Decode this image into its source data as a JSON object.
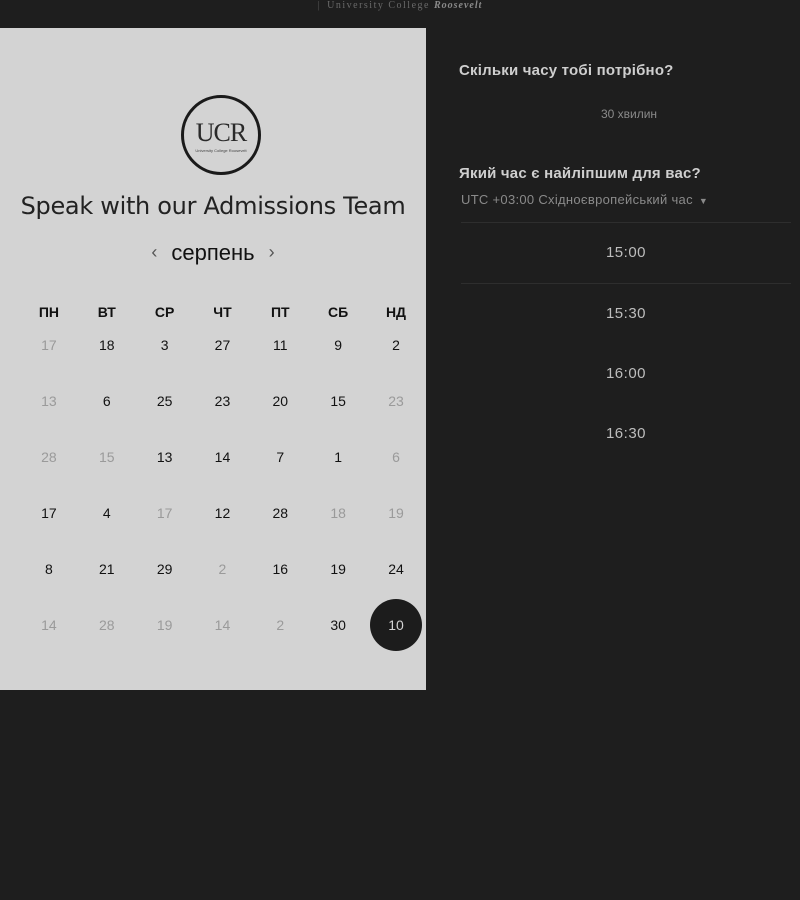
{
  "header": {
    "brand_prefix": "University College",
    "brand_name": "Roosevelt"
  },
  "logo": {
    "text": "UCR",
    "subtext": "University College Roosevelt"
  },
  "left_panel": {
    "title": "Speak with our Admissions Team",
    "month": "серпень",
    "prev_icon": "chevron-left-icon",
    "next_icon": "chevron-right-icon"
  },
  "calendar": {
    "weekdays": [
      "ПН",
      "ВТ",
      "СР",
      "ЧТ",
      "ПТ",
      "СБ",
      "НД"
    ],
    "weeks": [
      [
        {
          "d": "17",
          "s": "out"
        },
        {
          "d": "18",
          "s": "in"
        },
        {
          "d": "3",
          "s": "in"
        },
        {
          "d": "27",
          "s": "in"
        },
        {
          "d": "11",
          "s": "in"
        },
        {
          "d": "9",
          "s": "in"
        },
        {
          "d": "2",
          "s": "in"
        }
      ],
      [
        {
          "d": "13",
          "s": "out"
        },
        {
          "d": "6",
          "s": "in"
        },
        {
          "d": "25",
          "s": "in"
        },
        {
          "d": "23",
          "s": "in"
        },
        {
          "d": "20",
          "s": "in"
        },
        {
          "d": "15",
          "s": "in"
        },
        {
          "d": "23",
          "s": "out"
        }
      ],
      [
        {
          "d": "28",
          "s": "out"
        },
        {
          "d": "15",
          "s": "out"
        },
        {
          "d": "13",
          "s": "in"
        },
        {
          "d": "14",
          "s": "in"
        },
        {
          "d": "7",
          "s": "in"
        },
        {
          "d": "1",
          "s": "in"
        },
        {
          "d": "6",
          "s": "out"
        }
      ],
      [
        {
          "d": "17",
          "s": "in"
        },
        {
          "d": "4",
          "s": "in"
        },
        {
          "d": "17",
          "s": "out"
        },
        {
          "d": "12",
          "s": "in"
        },
        {
          "d": "28",
          "s": "in"
        },
        {
          "d": "18",
          "s": "out"
        },
        {
          "d": "19",
          "s": "out"
        }
      ],
      [
        {
          "d": "8",
          "s": "in"
        },
        {
          "d": "21",
          "s": "in"
        },
        {
          "d": "29",
          "s": "in"
        },
        {
          "d": "2",
          "s": "out"
        },
        {
          "d": "16",
          "s": "in"
        },
        {
          "d": "19",
          "s": "in"
        },
        {
          "d": "24",
          "s": "in"
        }
      ],
      [
        {
          "d": "14",
          "s": "out"
        },
        {
          "d": "28",
          "s": "out"
        },
        {
          "d": "19",
          "s": "out"
        },
        {
          "d": "14",
          "s": "out"
        },
        {
          "d": "2",
          "s": "out"
        },
        {
          "d": "30",
          "s": "in"
        },
        {
          "d": "10",
          "s": "sel"
        }
      ]
    ]
  },
  "right_panel": {
    "duration_question": "Скільки часу тобі потрібно?",
    "duration_value": "30 хвилин",
    "time_question": "Який час є найліпшим для вас?",
    "timezone": "UTC +03:00 Східноєвропейський час",
    "slots": [
      "15:00",
      "15:30",
      "16:00",
      "16:30"
    ]
  }
}
